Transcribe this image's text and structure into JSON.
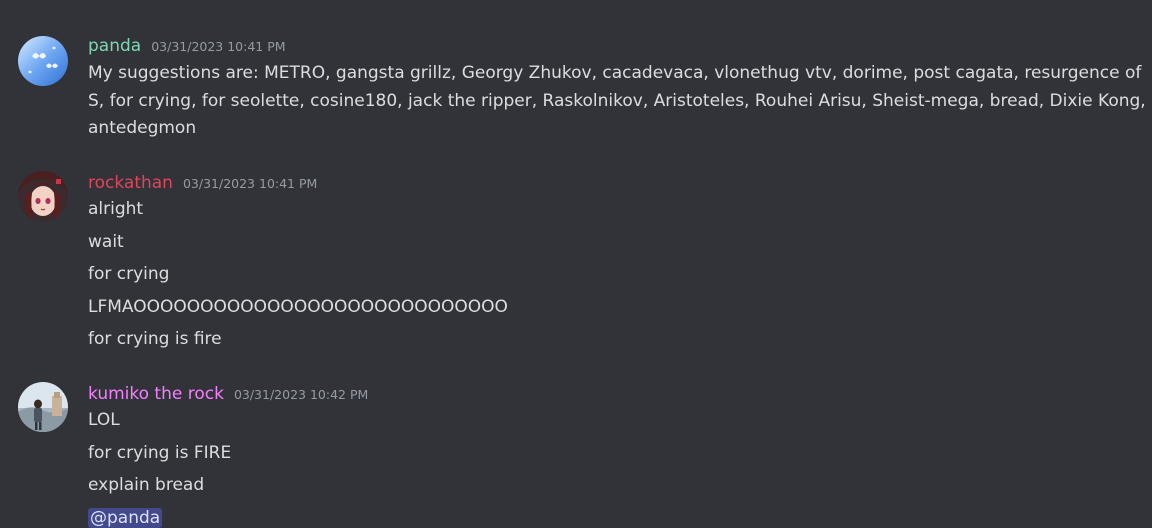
{
  "colors": {
    "background": "#313338",
    "text": "#dbdee1",
    "timestamp": "#949ba4",
    "mention_bg": "#4a4f9a"
  },
  "messages": [
    {
      "username": "panda",
      "username_color": "#7fd6b0",
      "timestamp": "03/31/2023 10:41 PM",
      "avatar_icon": "blue-sky-butterflies-avatar",
      "lines": [
        "My suggestions are: METRO, gangsta grillz, Georgy Zhukov, cacadevaca, vlonethug vtv, dorime, post cagata, resurgence of S, for crying, for seolette, cosine180, jack the ripper, Raskolnikov, Aristoteles, Rouhei Arisu, Sheist-mega, bread, Dixie Kong, antedegmon"
      ]
    },
    {
      "username": "rockathan",
      "username_color": "#e0455a",
      "timestamp": "03/31/2023 10:41 PM",
      "avatar_icon": "anime-girl-avatar",
      "lines": [
        "alright",
        "wait",
        "for crying",
        "LFMAOOOOOOOOOOOOOOOOOOOOOOOOOOOO",
        "for crying is fire"
      ]
    },
    {
      "username": "kumiko the rock",
      "username_color": "#f47fff",
      "timestamp": "03/31/2023 10:42 PM",
      "avatar_icon": "landscape-figure-avatar",
      "lines": [
        "LOL",
        "for crying is FIRE",
        "explain bread"
      ],
      "mention": "@panda"
    }
  ]
}
